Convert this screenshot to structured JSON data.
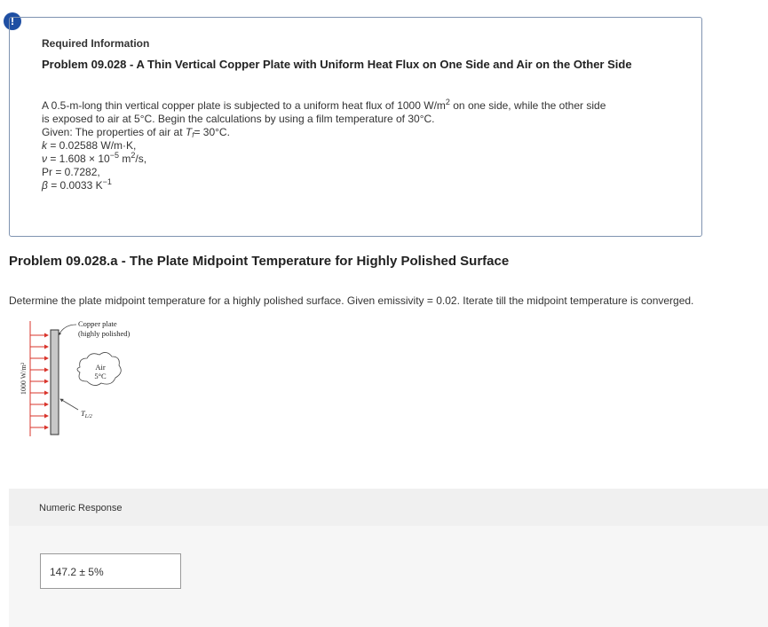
{
  "info": {
    "badge": "!",
    "heading": "Required Information",
    "title": "Problem 09.028 - A Thin Vertical Copper Plate with Uniform Heat Flux on One Side and Air on the Other Side",
    "body_line1_pre": "A 0.5-m-long thin vertical copper plate is subjected to a uniform heat flux of 1000 W/m",
    "body_line1_exp": "2",
    "body_line1_post": " on one side, while the other side",
    "body_line2": "is exposed to air at 5°C. Begin the calculations by using a film temperature of 30°C.",
    "given_pre": "Given: The properties of air at ",
    "given_T": "T",
    "given_sub": "f",
    "given_post": "= 30°C.",
    "k_sym": "k",
    "k_val": " = 0.02588 W/m·K,",
    "nu_sym": "ν",
    "nu_pre": " = 1.608 × 10",
    "nu_exp": "−5",
    "nu_mid": " m",
    "nu_exp2": "2",
    "nu_post": "/s,",
    "pr": "Pr = 0.7282,",
    "beta_sym": "β",
    "beta_val": " = 0.0033 K",
    "beta_exp": "−1"
  },
  "problem": {
    "title": "Problem 09.028.a - The Plate Midpoint Temperature for Highly Polished Surface",
    "question": "Determine the plate midpoint temperature for a highly polished surface. Given emissivity = 0.02. Iterate till the midpoint temperature is converged."
  },
  "figure": {
    "plate_label_1": "Copper plate",
    "plate_label_2": "(highly polished)",
    "air_label": "Air",
    "air_temp": "5°C",
    "flux_label": "1000 W/m²",
    "midpoint_label": "T",
    "midpoint_sub": "L/2"
  },
  "response": {
    "label": "Numeric Response",
    "value": "147.2 ± 5%"
  },
  "colors": {
    "badge": "#1f4fa3",
    "arrows": "#d9342b",
    "box_border": "#7f93b0"
  }
}
